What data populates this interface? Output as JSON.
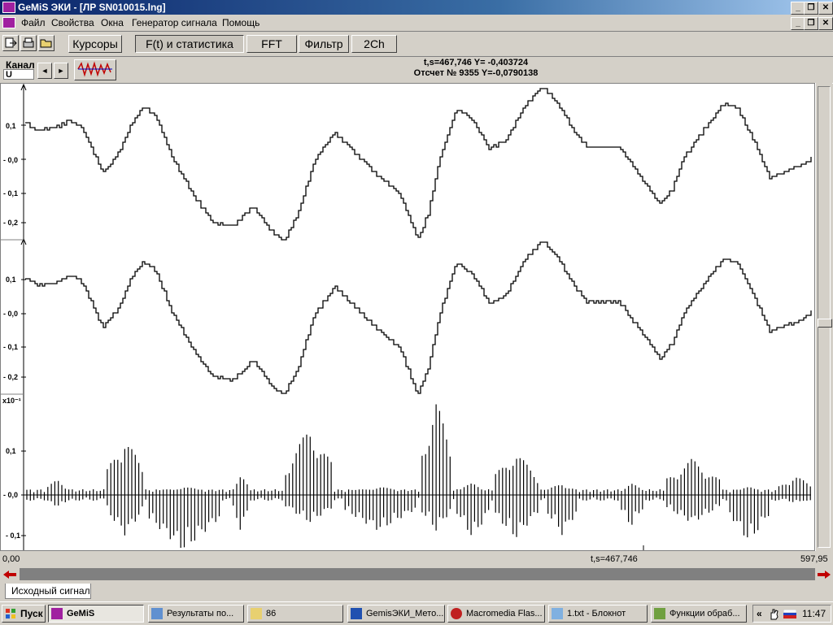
{
  "window": {
    "title": "GeMiS ЭКИ - [ЛР SN010015.lng]",
    "caption_buttons": [
      "_",
      "❐",
      "✕"
    ]
  },
  "menu": [
    "Файл",
    "Свойства",
    "Окна",
    "Генератор сигнала",
    "Помощь"
  ],
  "toolbar": {
    "icons": [
      "exit-icon",
      "print-icon",
      "open-folder-icon"
    ],
    "buttons": [
      "Курсоры",
      "F(t) и статистика",
      "FFT",
      "Фильтр",
      "2Ch"
    ],
    "active": "F(t) и статистика"
  },
  "channel": {
    "label": "Канал",
    "value": "U",
    "prev": "◄",
    "next": "►"
  },
  "readout": {
    "line1": "t,s=467,746  Y= -0,403724",
    "line2": "Отсчет № 9355 Y=-0,0790138"
  },
  "plot": {
    "panel1_ticks": [
      "0,1",
      "- 0,0",
      "- 0,1",
      "- 0,2"
    ],
    "panel2_ticks": [
      "0,1",
      "- 0,0",
      "- 0,1",
      "- 0,2"
    ],
    "panel3_scale": "x10⁻¹",
    "panel3_ticks": [
      "0,1",
      "- 0,0",
      "- 0,1"
    ]
  },
  "xaxis": {
    "start": "0,00",
    "cursor": "t,s=467,746",
    "end": "597,95"
  },
  "tab": "Исходный сигнал",
  "taskbar": {
    "start": "Пуск",
    "tasks": [
      "GeMiS",
      "Результаты по...",
      "86",
      "GemisЭКИ_Мето...",
      "Macromedia Flas...",
      "1.txt - Блокнот",
      "Функции обраб..."
    ],
    "tray_arrows": "«",
    "clock": "11:47"
  }
}
